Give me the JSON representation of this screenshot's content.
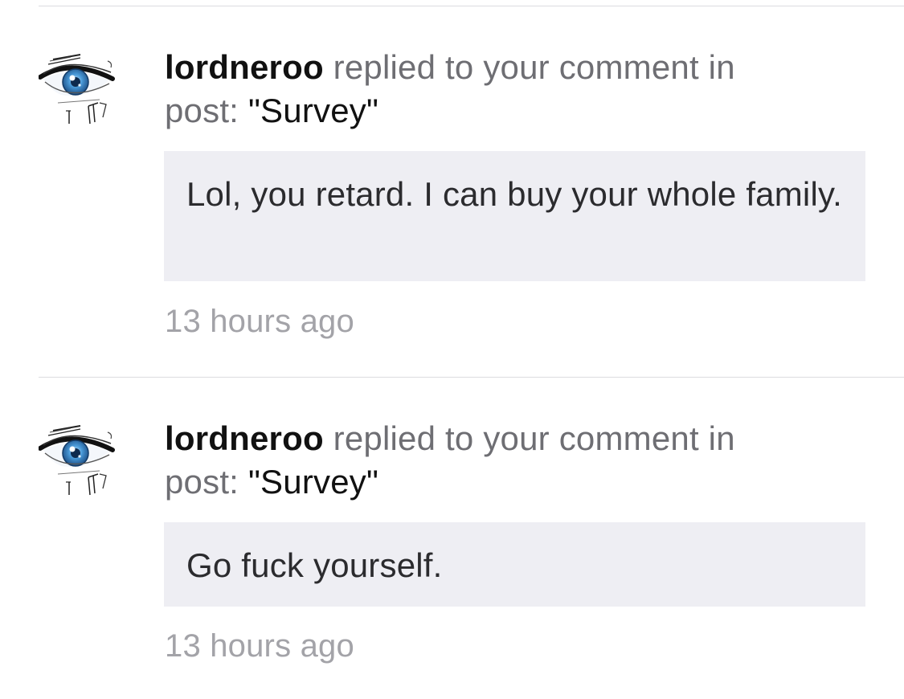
{
  "notifications": [
    {
      "username": "lordneroo",
      "action_text": "replied to your comment in",
      "post_prefix": "post:",
      "post_title": "\"Survey\"",
      "reply_text": "Lol, you retard. I can buy your whole family.",
      "timestamp": "13 hours ago",
      "avatar_icon": "eye-avatar-icon"
    },
    {
      "username": "lordneroo",
      "action_text": "replied to your comment in",
      "post_prefix": "post:",
      "post_title": "\"Survey\"",
      "reply_text": "Go fuck yourself.",
      "timestamp": "13 hours ago",
      "avatar_icon": "eye-avatar-icon"
    }
  ],
  "colors": {
    "username": "#111111",
    "secondary_text": "#6e6e73",
    "quote_background": "#eeeef3",
    "timestamp": "#a3a3a8",
    "divider": "#dcdce0",
    "iris": "#4a9ad8"
  }
}
